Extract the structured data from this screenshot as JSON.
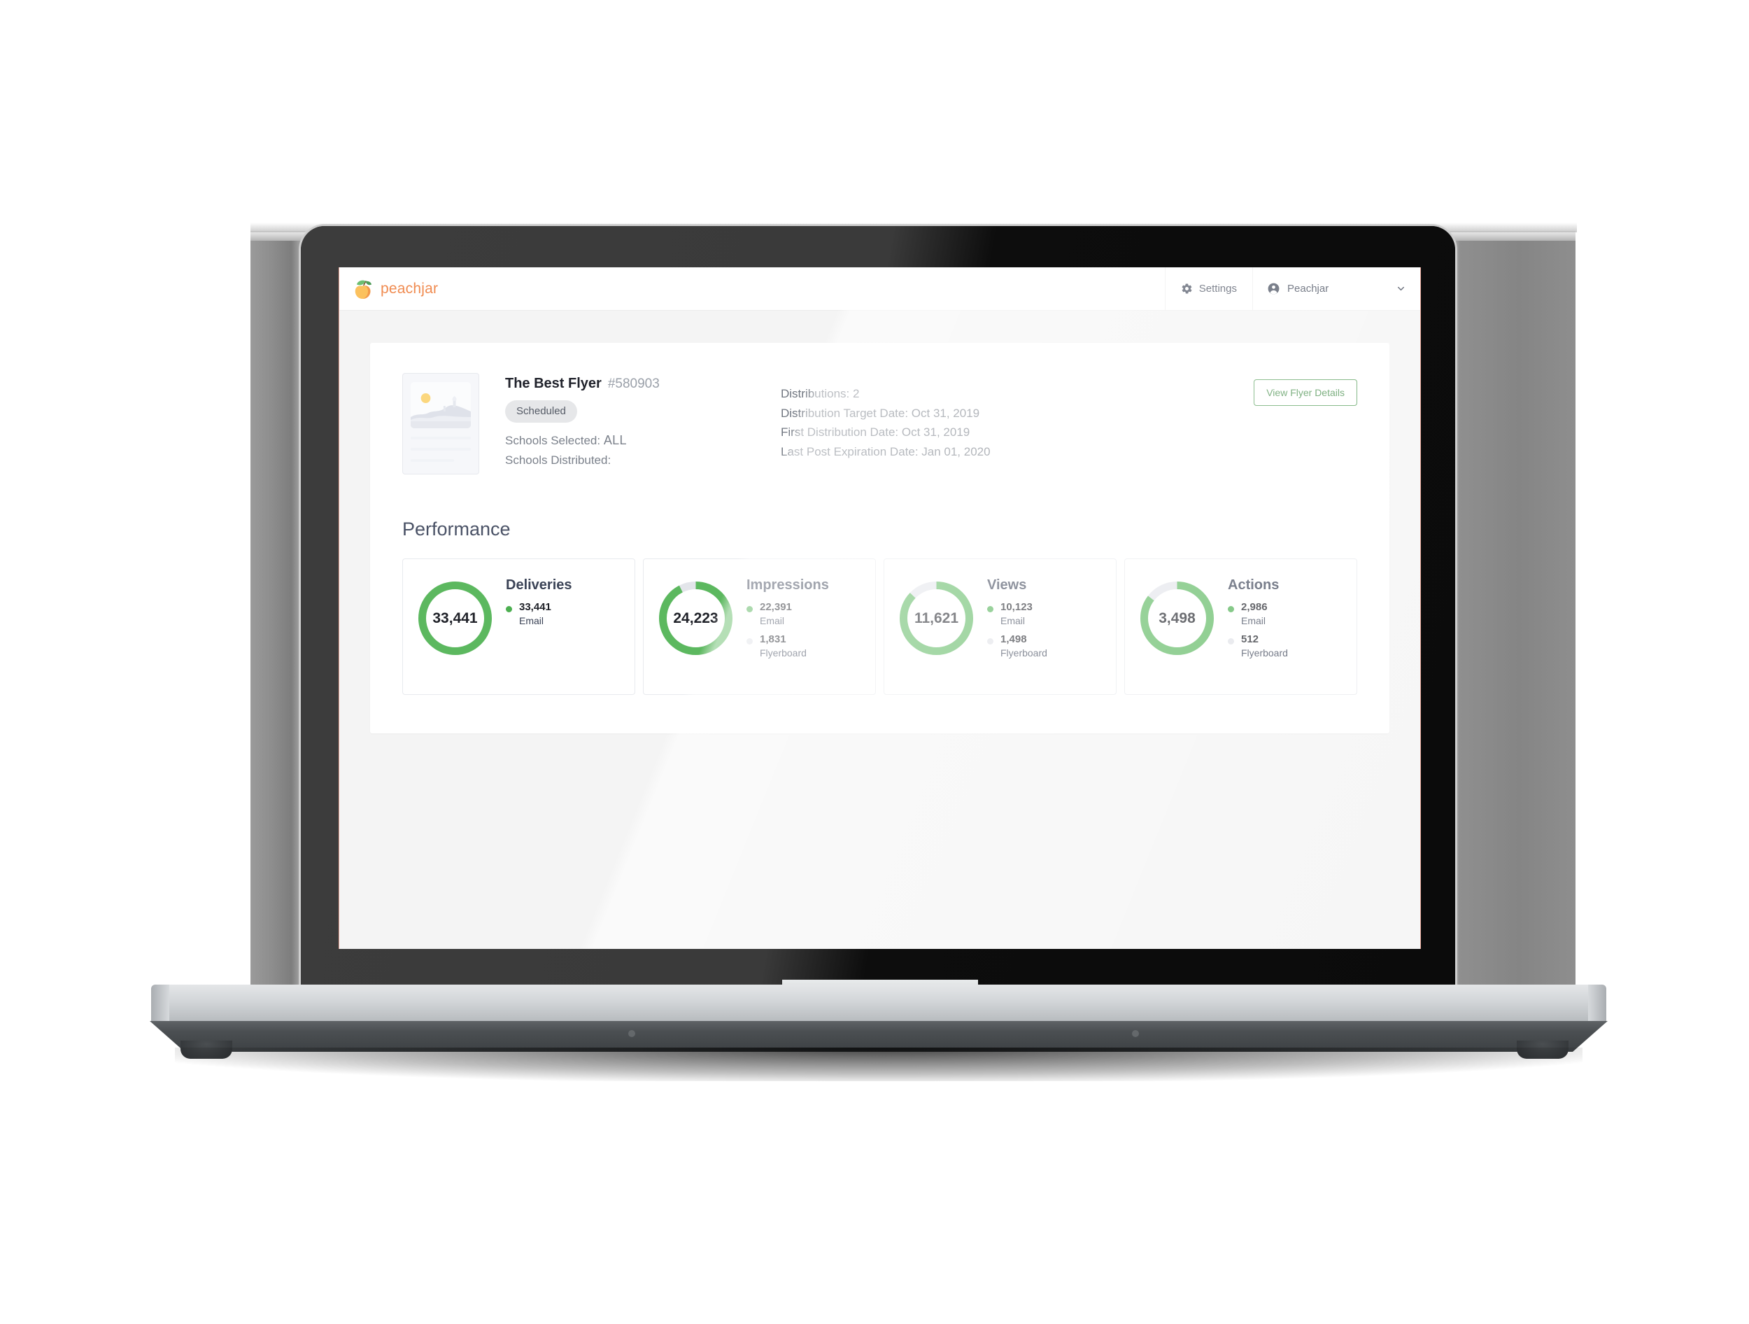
{
  "header": {
    "brand_name": "peachjar",
    "brand_icon": "peach-logo-icon",
    "settings_label": "Settings",
    "settings_icon": "gear-icon",
    "account_name": "Peachjar",
    "account_icon": "user-circle-icon",
    "chevron_icon": "chevron-down-icon"
  },
  "flyer": {
    "thumbnail_icon": "flyer-placeholder-image",
    "title": "The Best Flyer",
    "id": "#580903",
    "status": "Scheduled",
    "schools_selected_label": "Schools Selected:",
    "schools_selected_value": "ALL",
    "schools_distributed_label": "Schools Distributed:",
    "schools_distributed_value": "",
    "distributions": "Distributions: 2",
    "distribution_target_date": "Distribution Target Date: Oct 31, 2019",
    "first_distribution_date": "First Distribution Date: Oct 31, 2019",
    "last_post_expiration_date": "Last Post Expiration Date: Jan 01, 2020",
    "details_button": "View Flyer Details"
  },
  "performance": {
    "title": "Performance"
  },
  "colors": {
    "brand_orange": "#f08b50",
    "green": "#5cb85f",
    "track_gray": "#e3e5ea",
    "dot_green": "#4caf50",
    "dot_gray": "#e0e2e7",
    "button_green": "#3f8a44"
  },
  "chart_data": [
    {
      "type": "pie",
      "title": "Deliveries",
      "total": 33441,
      "total_label": "33,441",
      "labels": [
        "Email"
      ],
      "values": [
        33441
      ],
      "value_labels": [
        "33,441"
      ],
      "colors": [
        "#5cb85f"
      ],
      "legend": [
        {
          "value": "33,441",
          "source": "Email",
          "color": "#4caf50"
        }
      ]
    },
    {
      "type": "pie",
      "title": "Impressions",
      "total": 24223,
      "total_label": "24,223",
      "labels": [
        "Email",
        "Flyerboard"
      ],
      "values": [
        22391,
        1831
      ],
      "value_labels": [
        "22,391",
        "1,831"
      ],
      "colors": [
        "#5cb85f",
        "#e3e5ea"
      ],
      "legend": [
        {
          "value": "22,391",
          "source": "Email",
          "color": "#4caf50"
        },
        {
          "value": "1,831",
          "source": "Flyerboard",
          "color": "#e0e2e7"
        }
      ]
    },
    {
      "type": "pie",
      "title": "Views",
      "total": 11621,
      "total_label": "11,621",
      "labels": [
        "Email",
        "Flyerboard"
      ],
      "values": [
        10123,
        1498
      ],
      "value_labels": [
        "10,123",
        "1,498"
      ],
      "colors": [
        "#5cb85f",
        "#e3e5ea"
      ],
      "legend": [
        {
          "value": "10,123",
          "source": "Email",
          "color": "#4caf50"
        },
        {
          "value": "1,498",
          "source": "Flyerboard",
          "color": "#e0e2e7"
        }
      ]
    },
    {
      "type": "pie",
      "title": "Actions",
      "total": 3498,
      "total_label": "3,498",
      "labels": [
        "Email",
        "Flyerboard"
      ],
      "values": [
        2986,
        512
      ],
      "value_labels": [
        "2,986",
        "512"
      ],
      "colors": [
        "#5cb85f",
        "#e3e5ea"
      ],
      "legend": [
        {
          "value": "2,986",
          "source": "Email",
          "color": "#4caf50"
        },
        {
          "value": "512",
          "source": "Flyerboard",
          "color": "#e0e2e7"
        }
      ]
    }
  ]
}
